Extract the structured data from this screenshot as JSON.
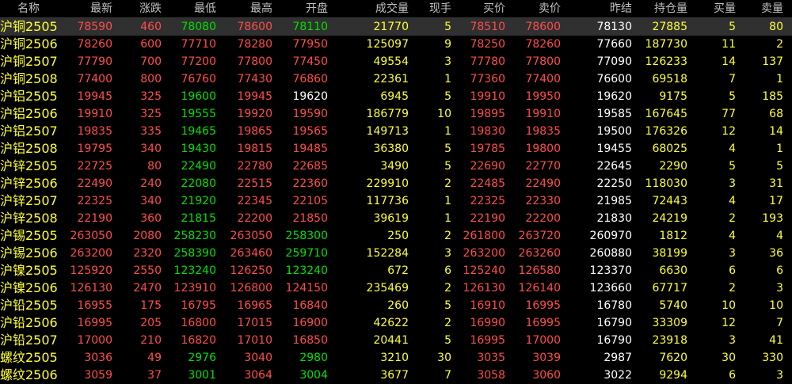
{
  "colors": {
    "up": "#ff4d4d",
    "down": "#00e000",
    "neutral": "#ffffff",
    "yellow": "#ffff33",
    "name": "#ffff33"
  },
  "columns": [
    {
      "key": "name",
      "label": "名称"
    },
    {
      "key": "last",
      "label": "最新"
    },
    {
      "key": "change",
      "label": "涨跌"
    },
    {
      "key": "low",
      "label": "最低"
    },
    {
      "key": "high",
      "label": "最高"
    },
    {
      "key": "open",
      "label": "开盘"
    },
    {
      "key": "volume",
      "label": "成交量"
    },
    {
      "key": "cur_vol",
      "label": "现手"
    },
    {
      "key": "bid",
      "label": "买价"
    },
    {
      "key": "ask",
      "label": "卖价"
    },
    {
      "key": "prev_settle",
      "label": "昨结"
    },
    {
      "key": "oi",
      "label": "持仓量"
    },
    {
      "key": "bid_qty",
      "label": "买量"
    },
    {
      "key": "ask_qty",
      "label": "卖量"
    }
  ],
  "selected_row": 0,
  "rows": [
    {
      "name": "沪铜2505",
      "last": "78590",
      "change": "460",
      "low": "78080",
      "high": "78600",
      "open": "78110",
      "volume": "21770",
      "cur_vol": "5",
      "bid": "78510",
      "ask": "78600",
      "prev_settle": "78130",
      "oi": "27885",
      "bid_qty": "5",
      "ask_qty": "80"
    },
    {
      "name": "沪铜2506",
      "last": "78260",
      "change": "600",
      "low": "77710",
      "high": "78280",
      "open": "77950",
      "volume": "125097",
      "cur_vol": "9",
      "bid": "78250",
      "ask": "78260",
      "prev_settle": "77660",
      "oi": "187730",
      "bid_qty": "11",
      "ask_qty": "2"
    },
    {
      "name": "沪铜2507",
      "last": "77790",
      "change": "700",
      "low": "77200",
      "high": "77800",
      "open": "77450",
      "volume": "49554",
      "cur_vol": "3",
      "bid": "77780",
      "ask": "77800",
      "prev_settle": "77090",
      "oi": "126233",
      "bid_qty": "14",
      "ask_qty": "137"
    },
    {
      "name": "沪铜2508",
      "last": "77400",
      "change": "800",
      "low": "76760",
      "high": "77430",
      "open": "76860",
      "volume": "22361",
      "cur_vol": "1",
      "bid": "77360",
      "ask": "77400",
      "prev_settle": "76600",
      "oi": "69518",
      "bid_qty": "7",
      "ask_qty": "1"
    },
    {
      "name": "沪铝2505",
      "last": "19945",
      "change": "325",
      "low": "19600",
      "high": "19945",
      "open": "19620",
      "volume": "6945",
      "cur_vol": "5",
      "bid": "19910",
      "ask": "19950",
      "prev_settle": "19620",
      "oi": "9175",
      "bid_qty": "5",
      "ask_qty": "185"
    },
    {
      "name": "沪铝2506",
      "last": "19910",
      "change": "325",
      "low": "19555",
      "high": "19920",
      "open": "19590",
      "volume": "186779",
      "cur_vol": "10",
      "bid": "19895",
      "ask": "19910",
      "prev_settle": "19585",
      "oi": "167645",
      "bid_qty": "77",
      "ask_qty": "68"
    },
    {
      "name": "沪铝2507",
      "last": "19835",
      "change": "335",
      "low": "19465",
      "high": "19865",
      "open": "19565",
      "volume": "149713",
      "cur_vol": "1",
      "bid": "19830",
      "ask": "19835",
      "prev_settle": "19500",
      "oi": "176326",
      "bid_qty": "12",
      "ask_qty": "14"
    },
    {
      "name": "沪铝2508",
      "last": "19795",
      "change": "340",
      "low": "19430",
      "high": "19815",
      "open": "19485",
      "volume": "36380",
      "cur_vol": "5",
      "bid": "19785",
      "ask": "19800",
      "prev_settle": "19455",
      "oi": "68025",
      "bid_qty": "4",
      "ask_qty": "1"
    },
    {
      "name": "沪锌2505",
      "last": "22725",
      "change": "80",
      "low": "22490",
      "high": "22780",
      "open": "22685",
      "volume": "3490",
      "cur_vol": "5",
      "bid": "22690",
      "ask": "22770",
      "prev_settle": "22645",
      "oi": "2290",
      "bid_qty": "5",
      "ask_qty": "5"
    },
    {
      "name": "沪锌2506",
      "last": "22490",
      "change": "240",
      "low": "22080",
      "high": "22515",
      "open": "22360",
      "volume": "229910",
      "cur_vol": "2",
      "bid": "22485",
      "ask": "22490",
      "prev_settle": "22250",
      "oi": "118030",
      "bid_qty": "3",
      "ask_qty": "31"
    },
    {
      "name": "沪锌2507",
      "last": "22325",
      "change": "340",
      "low": "21920",
      "high": "22345",
      "open": "22105",
      "volume": "117736",
      "cur_vol": "1",
      "bid": "22325",
      "ask": "22330",
      "prev_settle": "21985",
      "oi": "72443",
      "bid_qty": "4",
      "ask_qty": "17"
    },
    {
      "name": "沪锌2508",
      "last": "22190",
      "change": "360",
      "low": "21815",
      "high": "22200",
      "open": "21850",
      "volume": "39619",
      "cur_vol": "1",
      "bid": "22190",
      "ask": "22200",
      "prev_settle": "21830",
      "oi": "24219",
      "bid_qty": "2",
      "ask_qty": "193"
    },
    {
      "name": "沪锡2505",
      "last": "263050",
      "change": "2080",
      "low": "258230",
      "high": "263050",
      "open": "258300",
      "volume": "250",
      "cur_vol": "2",
      "bid": "261800",
      "ask": "263720",
      "prev_settle": "260970",
      "oi": "1812",
      "bid_qty": "4",
      "ask_qty": "4"
    },
    {
      "name": "沪锡2506",
      "last": "263200",
      "change": "2320",
      "low": "258390",
      "high": "263460",
      "open": "259710",
      "volume": "152284",
      "cur_vol": "3",
      "bid": "263200",
      "ask": "263260",
      "prev_settle": "260880",
      "oi": "38199",
      "bid_qty": "3",
      "ask_qty": "36"
    },
    {
      "name": "沪镍2505",
      "last": "125920",
      "change": "2550",
      "low": "123240",
      "high": "126250",
      "open": "123240",
      "volume": "672",
      "cur_vol": "6",
      "bid": "125240",
      "ask": "126580",
      "prev_settle": "123370",
      "oi": "6630",
      "bid_qty": "6",
      "ask_qty": "6"
    },
    {
      "name": "沪镍2506",
      "last": "126130",
      "change": "2470",
      "low": "123910",
      "high": "126800",
      "open": "124150",
      "volume": "235469",
      "cur_vol": "2",
      "bid": "126130",
      "ask": "126140",
      "prev_settle": "123660",
      "oi": "67717",
      "bid_qty": "2",
      "ask_qty": "3"
    },
    {
      "name": "沪铅2505",
      "last": "16955",
      "change": "175",
      "low": "16795",
      "high": "16965",
      "open": "16840",
      "volume": "260",
      "cur_vol": "5",
      "bid": "16910",
      "ask": "16995",
      "prev_settle": "16780",
      "oi": "5740",
      "bid_qty": "10",
      "ask_qty": "10"
    },
    {
      "name": "沪铅2506",
      "last": "16995",
      "change": "205",
      "low": "16800",
      "high": "17015",
      "open": "16900",
      "volume": "42622",
      "cur_vol": "2",
      "bid": "16990",
      "ask": "16995",
      "prev_settle": "16790",
      "oi": "33309",
      "bid_qty": "12",
      "ask_qty": "7"
    },
    {
      "name": "沪铅2507",
      "last": "17000",
      "change": "210",
      "low": "16820",
      "high": "17010",
      "open": "16850",
      "volume": "20441",
      "cur_vol": "5",
      "bid": "16995",
      "ask": "17000",
      "prev_settle": "16790",
      "oi": "23918",
      "bid_qty": "3",
      "ask_qty": "41"
    },
    {
      "name": "螺纹2505",
      "last": "3036",
      "change": "49",
      "low": "2976",
      "high": "3040",
      "open": "2980",
      "volume": "3210",
      "cur_vol": "30",
      "bid": "3035",
      "ask": "3039",
      "prev_settle": "2987",
      "oi": "7620",
      "bid_qty": "30",
      "ask_qty": "330"
    },
    {
      "name": "螺纹2506",
      "last": "3059",
      "change": "37",
      "low": "3001",
      "high": "3064",
      "open": "3004",
      "volume": "3677",
      "cur_vol": "7",
      "bid": "3058",
      "ask": "3060",
      "prev_settle": "3022",
      "oi": "9294",
      "bid_qty": "6",
      "ask_qty": "3"
    }
  ]
}
